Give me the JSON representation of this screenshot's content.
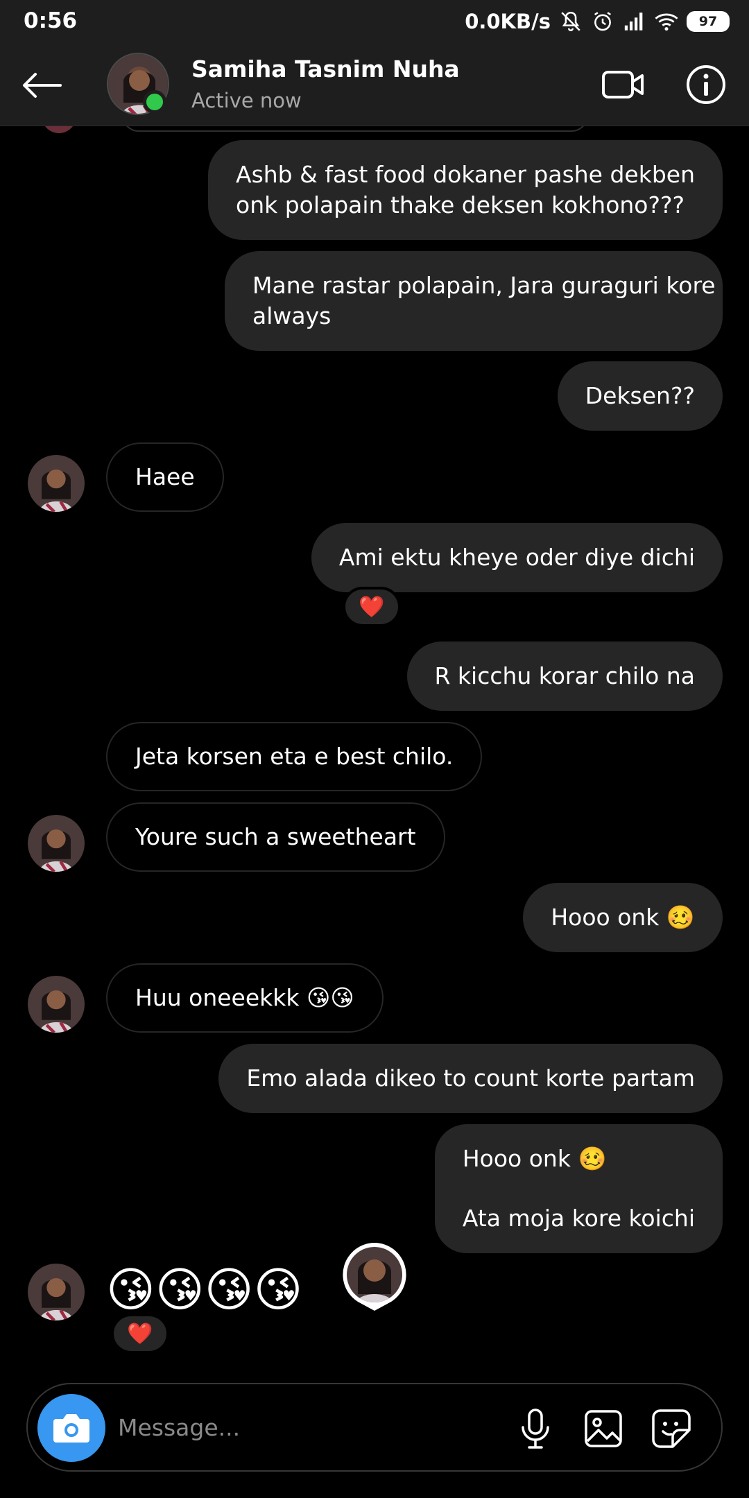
{
  "status_bar": {
    "time": "0:56",
    "net_speed": "0.0KB/s",
    "battery": "97",
    "icons": [
      "mute-icon",
      "alarm-icon",
      "signal-icon",
      "wifi-icon",
      "battery-icon"
    ]
  },
  "header": {
    "contact_name": "Samiha Tasnim Nuha",
    "status": "Active now",
    "online_color": "#31c94c"
  },
  "messages": [
    {
      "dir": "out",
      "lines": [
        "Ashb & fast food dokaner pashe dekben",
        "onk polapain thake deksen kokhono???"
      ]
    },
    {
      "dir": "out",
      "lines": [
        "Mane rastar polapain, Jara guraguri kore",
        "always"
      ]
    },
    {
      "dir": "out",
      "lines": [
        "Deksen??"
      ]
    },
    {
      "dir": "in",
      "lines": [
        "Haee"
      ]
    },
    {
      "dir": "out",
      "lines": [
        "Ami ektu kheye oder diye dichi"
      ],
      "reaction": "❤️"
    },
    {
      "dir": "out",
      "lines": [
        "R kicchu korar chilo na"
      ]
    },
    {
      "dir": "in",
      "lines": [
        "Jeta korsen eta e best chilo."
      ]
    },
    {
      "dir": "in",
      "lines": [
        "Youre such a sweetheart"
      ]
    },
    {
      "dir": "out",
      "lines": [
        "Hooo onk 🥴"
      ]
    },
    {
      "dir": "in",
      "lines": [
        "Huu oneeekkk 😘😘"
      ]
    },
    {
      "dir": "out",
      "lines": [
        "Emo alada dikeo to count korte partam"
      ]
    },
    {
      "dir": "out",
      "lines": [
        "Hooo onk 🥴",
        "",
        "Ata moja kore koichi"
      ]
    },
    {
      "dir": "in",
      "lines": [
        "😘😘😘😘"
      ],
      "reaction": "❤️"
    }
  ],
  "composer": {
    "placeholder": "Message...",
    "accent": "#3897f0"
  }
}
